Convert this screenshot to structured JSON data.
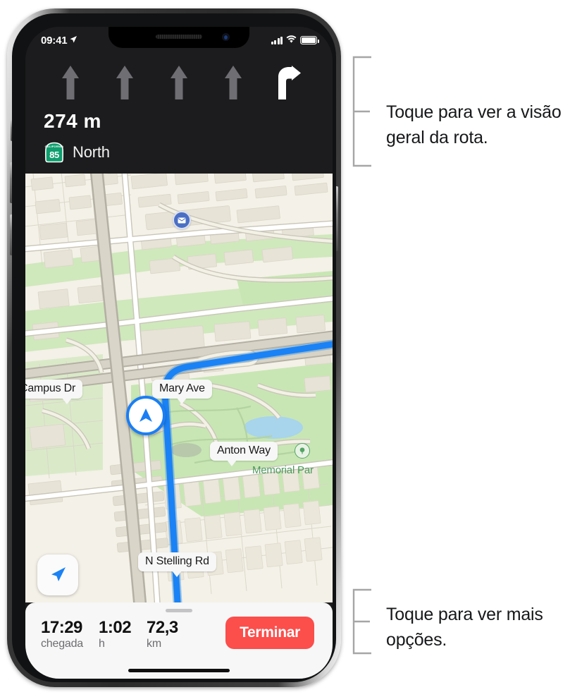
{
  "device": {
    "name": "iphone-x",
    "status_bar": {
      "time": "09:41",
      "location_arrow_icon": "location-arrow-icon",
      "cellular_icon": "signal-bars-icon",
      "wifi_icon": "wifi-icon",
      "battery_icon": "battery-full-icon"
    }
  },
  "nav_banner": {
    "lanes": [
      {
        "icon": "arrow-straight-icon",
        "state": "inactive"
      },
      {
        "icon": "arrow-straight-icon",
        "state": "inactive"
      },
      {
        "icon": "arrow-straight-icon",
        "state": "inactive"
      },
      {
        "icon": "arrow-straight-icon",
        "state": "inactive"
      },
      {
        "icon": "arrow-turn-right-icon",
        "state": "active"
      }
    ],
    "distance": "274 m",
    "shield": {
      "state_label": "CALIFORNIA",
      "route_number": "85",
      "color": "#0f9e6e"
    },
    "road_name": "North",
    "background_color": "#1c1c1e"
  },
  "map": {
    "labels": [
      {
        "id": "campus-dr",
        "text": "Campus Dr"
      },
      {
        "id": "mary-ave",
        "text": "Mary Ave"
      },
      {
        "id": "anton-way",
        "text": "Anton Way"
      },
      {
        "id": "n-stelling-rd",
        "text": "N Stelling Rd"
      }
    ],
    "park_name": "Memorial Par",
    "park_icon": "park-tree-icon",
    "poi_mail_icon": "mail-envelope-icon",
    "user_location_icon": "navigation-arrow-icon",
    "locate_button_icon": "navigation-arrow-icon",
    "route_color": "#1a82f5",
    "park_color": "#b8e0a8",
    "land_color": "#f4f1e8"
  },
  "bottom_sheet": {
    "grabber": "sheet-grabber",
    "eta_items": [
      {
        "value": "17:29",
        "unit": "chegada"
      },
      {
        "value": "1:02",
        "unit": "h"
      },
      {
        "value": "72,3",
        "unit": "km"
      }
    ],
    "end_button_label": "Terminar",
    "end_button_color": "#fc4e4b"
  },
  "callouts": [
    {
      "id": "callout-route-overview",
      "text": "Toque para ver a visão geral da rota."
    },
    {
      "id": "callout-more-options",
      "text": "Toque para ver mais opções."
    }
  ]
}
